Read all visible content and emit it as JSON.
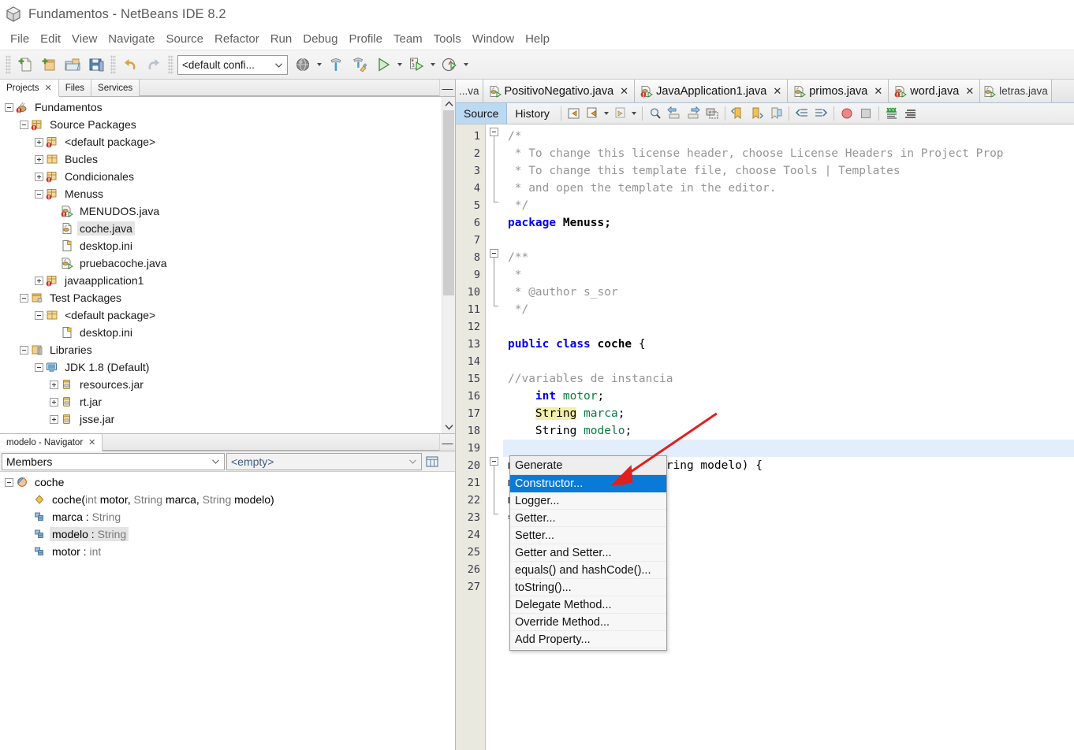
{
  "window": {
    "title": "Fundamentos - NetBeans IDE 8.2",
    "app_icon": "netbeans-cube-icon"
  },
  "menubar": {
    "items": [
      "File",
      "Edit",
      "View",
      "Navigate",
      "Source",
      "Refactor",
      "Run",
      "Debug",
      "Profile",
      "Team",
      "Tools",
      "Window",
      "Help"
    ]
  },
  "toolbar": {
    "buttons": [
      {
        "name": "new-file-button",
        "icon": "new-file-icon"
      },
      {
        "name": "new-project-button",
        "icon": "new-project-icon"
      },
      {
        "name": "open-project-button",
        "icon": "open-project-icon"
      },
      {
        "name": "save-all-button",
        "icon": "save-all-icon"
      },
      {
        "name": "undo-button",
        "icon": "undo-icon"
      },
      {
        "name": "redo-button",
        "icon": "redo-icon"
      }
    ],
    "config_combo": {
      "value": "<default confi...",
      "name": "configuration-combo"
    },
    "right_buttons": [
      {
        "name": "set-browser-button",
        "icon": "globe-icon"
      },
      {
        "name": "build-project-button",
        "icon": "hammer-icon"
      },
      {
        "name": "clean-and-build-button",
        "icon": "hammer-broom-icon"
      },
      {
        "name": "run-project-button",
        "icon": "play-icon"
      },
      {
        "name": "debug-project-button",
        "icon": "debug-icon"
      },
      {
        "name": "profile-project-button",
        "icon": "profile-clock-icon"
      }
    ]
  },
  "explorer": {
    "tabs": [
      {
        "label": "Projects",
        "closable": true,
        "active": true
      },
      {
        "label": "Files",
        "closable": false,
        "active": false
      },
      {
        "label": "Services",
        "closable": false,
        "active": false
      }
    ],
    "minimize_glyph": "—",
    "tree": [
      {
        "label": "Fundamentos",
        "depth": 0,
        "toggle": "minus",
        "icon": "java-project-icon",
        "selected": false
      },
      {
        "label": "Source Packages",
        "depth": 1,
        "toggle": "minus",
        "icon": "source-packages-icon",
        "selected": false
      },
      {
        "label": "<default package>",
        "depth": 2,
        "toggle": "plus",
        "icon": "package-error-icon",
        "selected": false
      },
      {
        "label": "Bucles",
        "depth": 2,
        "toggle": "plus",
        "icon": "package-icon",
        "selected": false
      },
      {
        "label": "Condicionales",
        "depth": 2,
        "toggle": "plus",
        "icon": "package-error-icon",
        "selected": false
      },
      {
        "label": "Menuss",
        "depth": 2,
        "toggle": "minus",
        "icon": "package-error-icon",
        "selected": false
      },
      {
        "label": "MENUDOS.java",
        "depth": 3,
        "toggle": "none",
        "icon": "java-main-error-icon",
        "selected": false
      },
      {
        "label": "coche.java",
        "depth": 3,
        "toggle": "none",
        "icon": "java-file-icon",
        "selected": true
      },
      {
        "label": "desktop.ini",
        "depth": 3,
        "toggle": "none",
        "icon": "ini-file-icon",
        "selected": false
      },
      {
        "label": "pruebacoche.java",
        "depth": 3,
        "toggle": "none",
        "icon": "java-main-icon",
        "selected": false
      },
      {
        "label": "javaapplication1",
        "depth": 2,
        "toggle": "plus",
        "icon": "package-error-icon",
        "selected": false
      },
      {
        "label": "Test Packages",
        "depth": 1,
        "toggle": "minus",
        "icon": "test-packages-icon",
        "selected": false
      },
      {
        "label": "<default package>",
        "depth": 2,
        "toggle": "minus",
        "icon": "package-icon",
        "selected": false
      },
      {
        "label": "desktop.ini",
        "depth": 3,
        "toggle": "none",
        "icon": "ini-file-icon",
        "selected": false
      },
      {
        "label": "Libraries",
        "depth": 1,
        "toggle": "minus",
        "icon": "libraries-icon",
        "selected": false
      },
      {
        "label": "JDK 1.8 (Default)",
        "depth": 2,
        "toggle": "minus",
        "icon": "jdk-icon",
        "selected": false
      },
      {
        "label": "resources.jar",
        "depth": 3,
        "toggle": "plus",
        "icon": "jar-icon",
        "selected": false
      },
      {
        "label": "rt.jar",
        "depth": 3,
        "toggle": "plus",
        "icon": "jar-icon",
        "selected": false
      },
      {
        "label": "jsse.jar",
        "depth": 3,
        "toggle": "plus",
        "icon": "jar-icon",
        "selected": false
      }
    ]
  },
  "navigator": {
    "tab_label": "modelo - Navigator",
    "minimize_glyph": "—",
    "scope_combo": "Members",
    "filter_combo": "<empty>",
    "members": [
      {
        "name": "coche",
        "depth": 0,
        "toggle": "minus",
        "icon": "class-icon",
        "selected": false,
        "type": ""
      },
      {
        "name": "coche(",
        "depth": 1,
        "toggle": "none",
        "icon": "constructor-icon",
        "selected": false,
        "sig_parts": [
          {
            "t": "int ",
            "k": "type"
          },
          {
            "t": "motor, ",
            "k": "plain"
          },
          {
            "t": "String ",
            "k": "type"
          },
          {
            "t": "marca, ",
            "k": "plain"
          },
          {
            "t": "String ",
            "k": "type"
          },
          {
            "t": "modelo)",
            "k": "plain"
          }
        ]
      },
      {
        "name": "marca : ",
        "depth": 1,
        "toggle": "none",
        "icon": "field-icon",
        "selected": false,
        "type": "String"
      },
      {
        "name": "modelo : ",
        "depth": 1,
        "toggle": "none",
        "icon": "field-icon",
        "selected": true,
        "type": "String"
      },
      {
        "name": "motor : ",
        "depth": 1,
        "toggle": "none",
        "icon": "field-icon",
        "selected": false,
        "type": "int"
      }
    ]
  },
  "editor": {
    "tabs": [
      {
        "label": "...va",
        "icon": "none",
        "closable": false,
        "partial": true,
        "active": false
      },
      {
        "label": "PositivoNegativo.java",
        "icon": "java-main-icon",
        "closable": true,
        "partial": false,
        "active": false
      },
      {
        "label": "JavaApplication1.java",
        "icon": "java-main-error-icon",
        "closable": true,
        "partial": false,
        "active": false
      },
      {
        "label": "primos.java",
        "icon": "java-main-icon",
        "closable": true,
        "partial": false,
        "active": false
      },
      {
        "label": "word.java",
        "icon": "java-main-error-icon",
        "closable": true,
        "partial": false,
        "active": false
      },
      {
        "label": "letras.java",
        "icon": "java-main-icon",
        "closable": false,
        "partial": true,
        "active": false
      }
    ],
    "view_tabs": [
      {
        "label": "Source",
        "active": true
      },
      {
        "label": "History",
        "active": false
      }
    ],
    "toolbar_buttons": [
      {
        "name": "last-edit-button",
        "icon": "last-edit-icon"
      },
      {
        "name": "back-button",
        "icon": "nav-back-icon"
      },
      {
        "name": "forward-button",
        "icon": "nav-forward-icon"
      },
      {
        "name": "find-selection-button",
        "icon": "find-selection-icon"
      },
      {
        "name": "find-previous-button",
        "icon": "find-previous-icon"
      },
      {
        "name": "find-next-button",
        "icon": "find-next-icon"
      },
      {
        "name": "toggle-rect-selection-button",
        "icon": "rect-selection-icon"
      },
      {
        "name": "previous-bookmark-button",
        "icon": "previous-bookmark-icon"
      },
      {
        "name": "next-bookmark-button",
        "icon": "next-bookmark-icon"
      },
      {
        "name": "toggle-bookmark-button",
        "icon": "toggle-bookmark-icon"
      },
      {
        "name": "shift-left-button",
        "icon": "shift-left-icon"
      },
      {
        "name": "shift-right-button",
        "icon": "shift-right-icon"
      },
      {
        "name": "toggle-breakpoint-button",
        "icon": "breakpoint-icon"
      },
      {
        "name": "stop-button",
        "icon": "stop-icon"
      },
      {
        "name": "toggle-highlight-button",
        "icon": "highlight-icon"
      },
      {
        "name": "toggle-comment-button",
        "icon": "comment-lines-icon"
      }
    ],
    "file": "coche.java",
    "first_line": 1,
    "last_line": 27,
    "current_line": 19,
    "lines": [
      {
        "n": 1,
        "tokens": [
          {
            "t": "/*",
            "c": "com"
          }
        ]
      },
      {
        "n": 2,
        "tokens": [
          {
            "t": " * To change this license header, choose License Headers in Project Prop",
            "c": "com"
          }
        ]
      },
      {
        "n": 3,
        "tokens": [
          {
            "t": " * To change this template file, choose Tools | Templates",
            "c": "com"
          }
        ]
      },
      {
        "n": 4,
        "tokens": [
          {
            "t": " * and open the template in the editor.",
            "c": "com"
          }
        ]
      },
      {
        "n": 5,
        "tokens": [
          {
            "t": " */",
            "c": "com"
          }
        ]
      },
      {
        "n": 6,
        "tokens": [
          {
            "t": "package",
            "c": "kw"
          },
          {
            "t": " Menuss;",
            "c": "cls"
          }
        ]
      },
      {
        "n": 7,
        "tokens": []
      },
      {
        "n": 8,
        "tokens": [
          {
            "t": "/**",
            "c": "com"
          }
        ]
      },
      {
        "n": 9,
        "tokens": [
          {
            "t": " *",
            "c": "com"
          }
        ]
      },
      {
        "n": 10,
        "tokens": [
          {
            "t": " * @author s_sor",
            "c": "com"
          }
        ]
      },
      {
        "n": 11,
        "tokens": [
          {
            "t": " */",
            "c": "com"
          }
        ]
      },
      {
        "n": 12,
        "tokens": []
      },
      {
        "n": 13,
        "tokens": [
          {
            "t": "public",
            "c": "kw"
          },
          {
            "t": " ",
            "c": "plain"
          },
          {
            "t": "class",
            "c": "kw"
          },
          {
            "t": " ",
            "c": "plain"
          },
          {
            "t": "coche",
            "c": "cls"
          },
          {
            "t": " {",
            "c": "plain"
          }
        ]
      },
      {
        "n": 14,
        "tokens": []
      },
      {
        "n": 15,
        "tokens": [
          {
            "t": "//variables de instancia",
            "c": "com"
          }
        ]
      },
      {
        "n": 16,
        "tokens": [
          {
            "t": "    ",
            "c": "plain"
          },
          {
            "t": "int",
            "c": "kw"
          },
          {
            "t": " ",
            "c": "plain"
          },
          {
            "t": "motor",
            "c": "fld"
          },
          {
            "t": ";",
            "c": "plain"
          }
        ]
      },
      {
        "n": 17,
        "tokens": [
          {
            "t": "    ",
            "c": "plain"
          },
          {
            "t": "String",
            "c": "hl"
          },
          {
            "t": " ",
            "c": "plain"
          },
          {
            "t": "marca",
            "c": "fld"
          },
          {
            "t": ";",
            "c": "plain"
          }
        ]
      },
      {
        "n": 18,
        "tokens": [
          {
            "t": "    ",
            "c": "plain"
          },
          {
            "t": "String",
            "c": "plain"
          },
          {
            "t": " ",
            "c": "plain"
          },
          {
            "t": "modelo",
            "c": "fld"
          },
          {
            "t": ";",
            "c": "plain"
          }
        ]
      },
      {
        "n": 19,
        "tokens": []
      },
      {
        "n": 20,
        "tokens": [
          {
            "t": "motor, String marca, String modelo) {",
            "c": "plain"
          }
        ]
      },
      {
        "n": 21,
        "tokens": [
          {
            "t": "motor;",
            "c": "plain"
          }
        ]
      },
      {
        "n": 22,
        "tokens": [
          {
            "t": "marca;",
            "c": "plain"
          }
        ]
      },
      {
        "n": 23,
        "tokens": [
          {
            "t": "= modelo;",
            "c": "plain"
          }
        ]
      },
      {
        "n": 24,
        "tokens": []
      },
      {
        "n": 25,
        "tokens": []
      },
      {
        "n": 26,
        "tokens": []
      },
      {
        "n": 27,
        "tokens": []
      }
    ]
  },
  "generate_menu": {
    "header": "Generate",
    "items": [
      {
        "label": "Constructor...",
        "selected": true
      },
      {
        "label": "Logger...",
        "selected": false
      },
      {
        "label": "Getter...",
        "selected": false
      },
      {
        "label": "Setter...",
        "selected": false
      },
      {
        "label": "Getter and Setter...",
        "selected": false
      },
      {
        "label": "equals() and hashCode()...",
        "selected": false
      },
      {
        "label": "toString()...",
        "selected": false
      },
      {
        "label": "Delegate Method...",
        "selected": false
      },
      {
        "label": "Override Method...",
        "selected": false
      },
      {
        "label": "Add Property...",
        "selected": false
      }
    ]
  },
  "annotation": {
    "arrow_color": "#e02020",
    "name": "red-arrow-annotation"
  },
  "colors": {
    "selection_blue": "#0a7ad8",
    "current_line": "#e3eefc",
    "highlight_yellow": "#f2f0a8",
    "tab_active": "#bcd9f2"
  }
}
